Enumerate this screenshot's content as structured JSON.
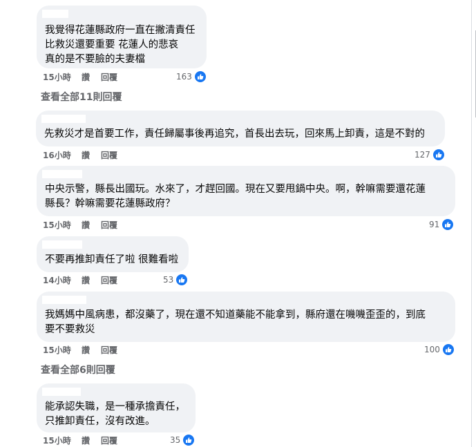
{
  "comments": [
    {
      "text": "我覺得花蓮縣政府一直在撇清責任\n比救災還要重要 花蓮人的悲哀\n真的是不要臉的夫妻檔",
      "time": "15小時",
      "like": "讚",
      "reply": "回覆",
      "count": "163"
    },
    {
      "text": "先救災才是首要工作，責任歸屬事後再追究，首長出去玩，回來馬上卸責，這是不對的",
      "time": "16小時",
      "like": "讚",
      "reply": "回覆",
      "count": "127"
    },
    {
      "text": "中央示警，縣長出國玩。水來了，才趕回國。現在又要甩鍋中央。啊，幹嘛需要還花蓮\n縣長？幹嘛需要花蓮縣政府？",
      "time": "15小時",
      "like": "讚",
      "reply": "回覆",
      "count": "91"
    },
    {
      "text": "不要再推卸責任了啦 很難看啦",
      "time": "14小時",
      "like": "讚",
      "reply": "回覆",
      "count": "53"
    },
    {
      "text": "我媽媽中風病患，都沒藥了，現在還不知道藥能不能拿到，縣府還在嘰嘰歪歪的，到底\n要不要救災",
      "time": "15小時",
      "like": "讚",
      "reply": "回覆",
      "count": "100"
    },
    {
      "text": "能承認失職，是一種承擔責任，\n只推卸責任，沒有改進。",
      "time": "15小時",
      "like": "讚",
      "reply": "回覆",
      "count": "35"
    }
  ],
  "see_all": [
    "查看全部11則回覆",
    "查看全部6則回覆"
  ],
  "icons": {
    "reaction": "like-thumb-icon",
    "accent": "#1877f2"
  }
}
